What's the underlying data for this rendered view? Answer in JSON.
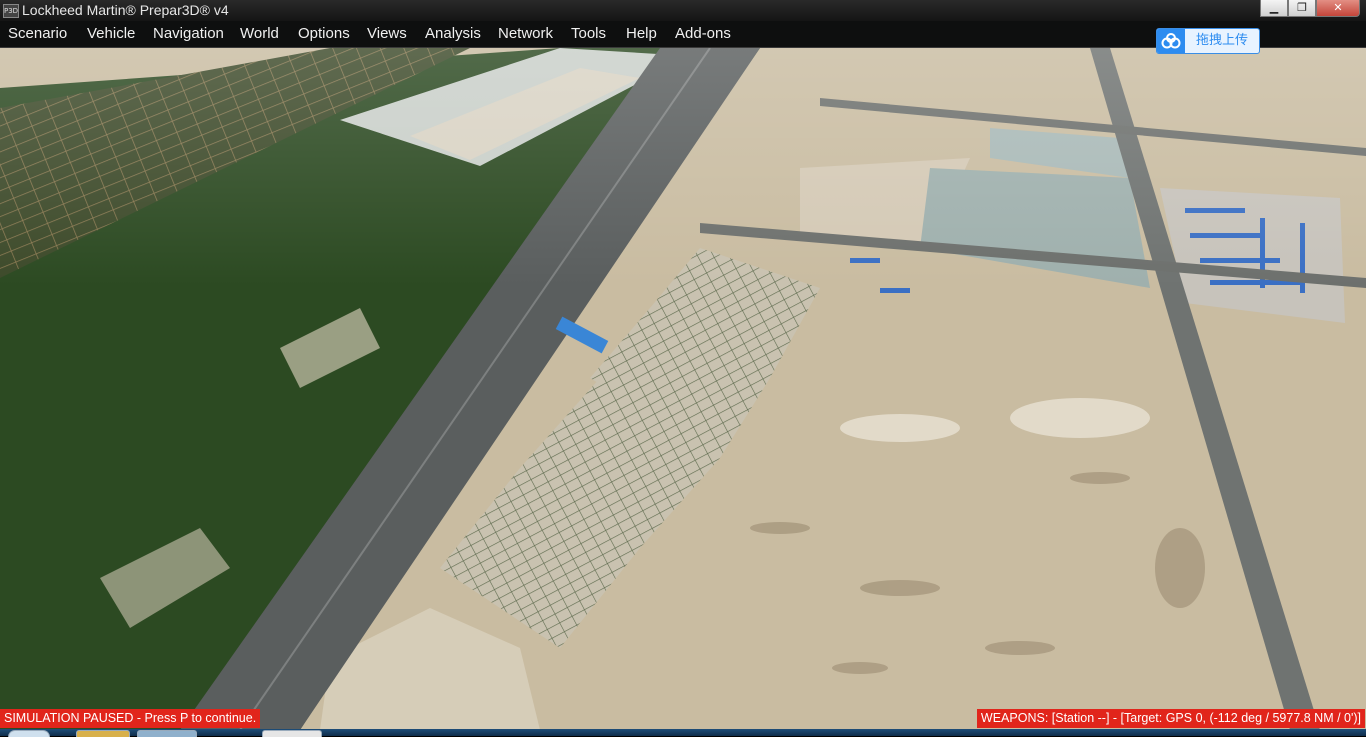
{
  "window": {
    "title": "Lockheed Martin® Prepar3D® v4",
    "app_icon_text": "P3D",
    "minimize_glyph": "▁",
    "maximize_glyph": "❐",
    "close_glyph": "✕"
  },
  "menu": {
    "items": [
      {
        "label": "Scenario"
      },
      {
        "label": "Vehicle"
      },
      {
        "label": "Navigation"
      },
      {
        "label": "World"
      },
      {
        "label": "Options"
      },
      {
        "label": "Views"
      },
      {
        "label": "Analysis"
      },
      {
        "label": "Network"
      },
      {
        "label": "Tools"
      },
      {
        "label": "Help"
      },
      {
        "label": "Add-ons"
      }
    ]
  },
  "upload_button": {
    "label": "拖拽上传",
    "icon": "cloud-icon",
    "color": "#2d8cf0"
  },
  "status": {
    "paused": "SIMULATION PAUSED - Press P to continue.",
    "weapons": "WEAPONS: [Station --] - [Target: GPS 0, (-112 deg / 5977.8 NM / 0')]",
    "color": "#e1251b"
  },
  "colors": {
    "fields": "#2c4a22",
    "sand": "#cbbda2",
    "highway": "#55595a",
    "roofs_blue": "#3a6fc4"
  }
}
